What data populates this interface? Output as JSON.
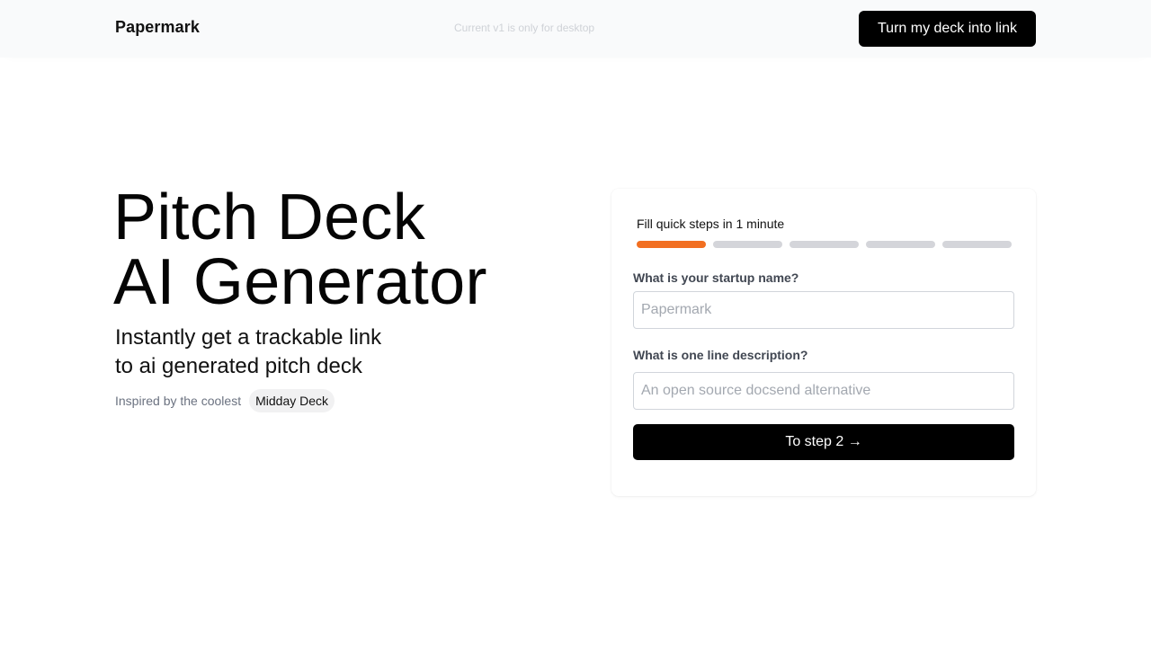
{
  "header": {
    "brand": "Papermark",
    "notice": "Current v1 is only for desktop",
    "cta_label": "Turn my deck into link"
  },
  "hero": {
    "title_lines": [
      "Pitch Deck",
      "AI Generator"
    ],
    "subtitle_lines": [
      "Instantly get a trackable link",
      "to ai generated pitch deck"
    ],
    "inspired_text": "Inspired by the coolest",
    "inspired_badge": "Midday Deck"
  },
  "form": {
    "steps_title": "Fill quick steps in 1 minute",
    "progress": {
      "total_steps": 5,
      "current_step": 1,
      "active_color": "#f26f21",
      "inactive_color": "#d4d5da"
    },
    "fields": [
      {
        "label": "What is your startup name?",
        "value": "",
        "placeholder": "Papermark"
      },
      {
        "label": "What is one line description?",
        "value": "",
        "placeholder": "An open source docsend alternative"
      }
    ],
    "submit_label": "To step 2 →"
  }
}
